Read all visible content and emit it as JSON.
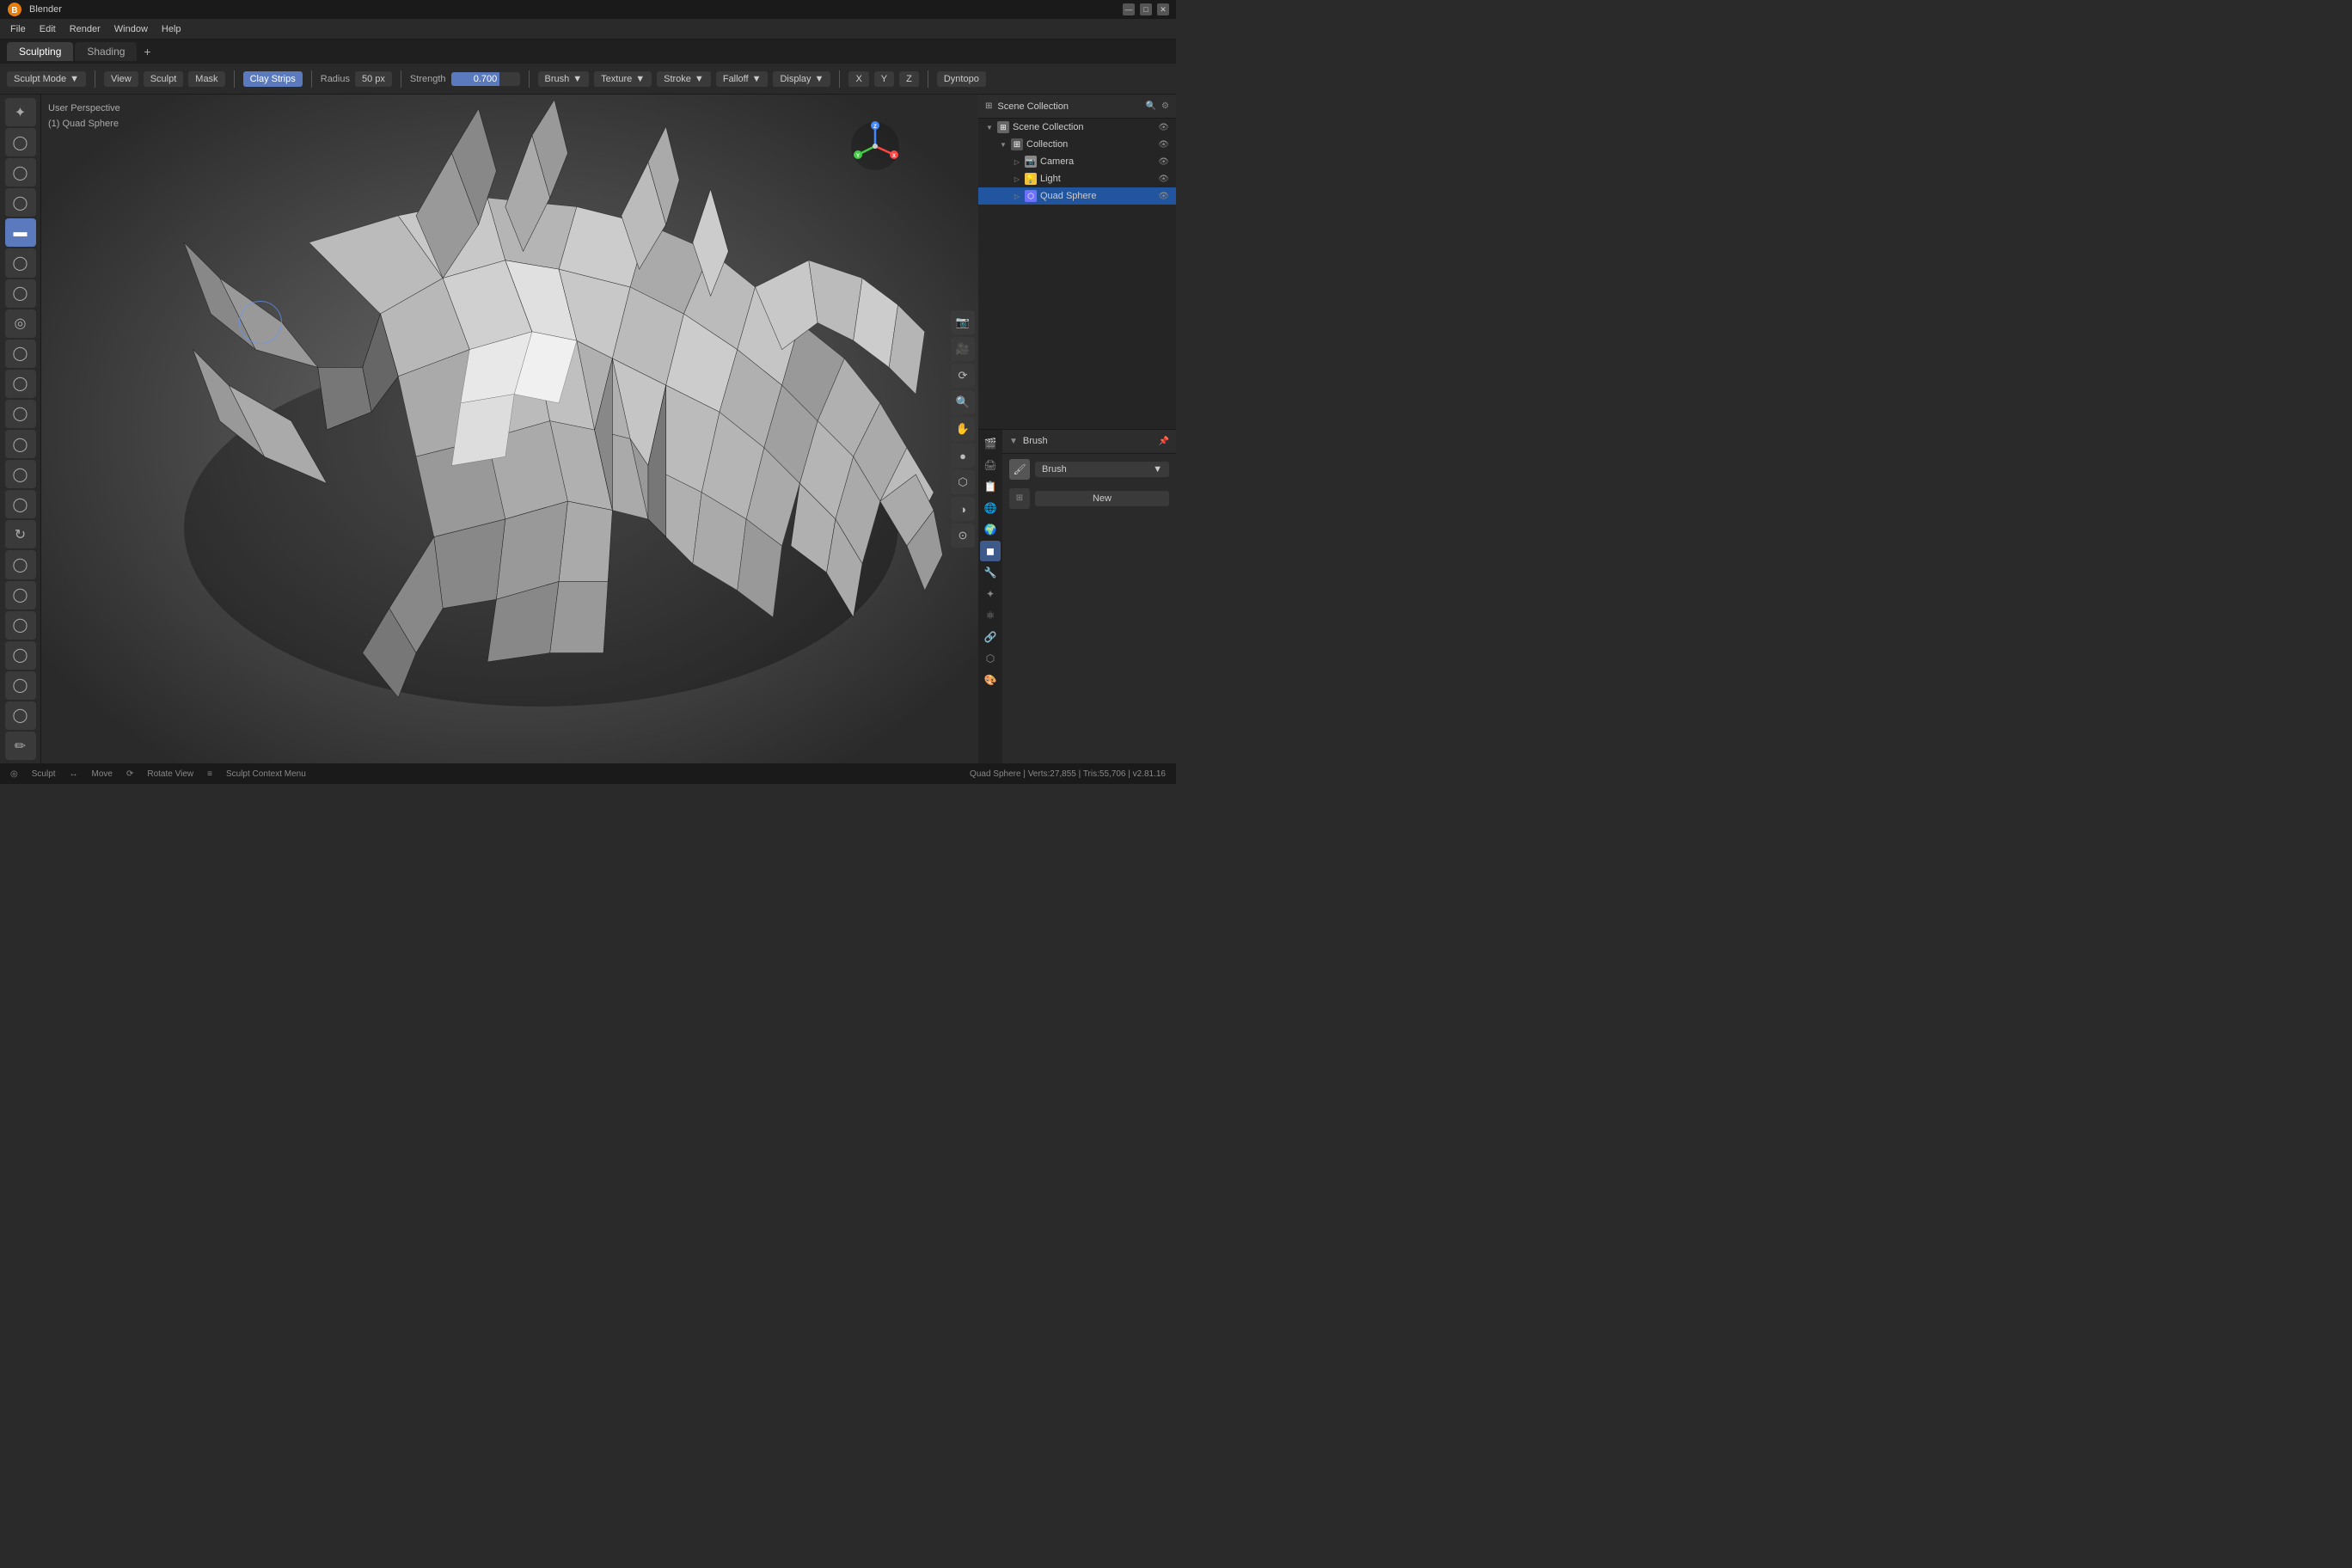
{
  "titleBar": {
    "appName": "Blender",
    "controls": [
      "—",
      "□",
      "✕"
    ]
  },
  "menuBar": {
    "items": [
      "File",
      "Edit",
      "Render",
      "Window",
      "Help"
    ]
  },
  "workspaceTabs": {
    "tabs": [
      "Sculpting",
      "Shading"
    ],
    "activeTab": "Sculpting",
    "addLabel": "+"
  },
  "topToolbar": {
    "modeLabel": "Sculpt Mode",
    "modeDropdown": "▼",
    "viewLabel": "View",
    "sculptLabel": "Sculpt",
    "maskLabel": "Mask",
    "brushName": "Clay Strips",
    "radiusLabel": "Radius",
    "radiusValue": "50 px",
    "strengthLabel": "Strength",
    "strengthValue": "0.700",
    "brushLabel": "Brush",
    "textureLabel": "Texture",
    "strokeLabel": "Stroke",
    "falloffLabel": "Falloff",
    "displayLabel": "Display",
    "dyntopo": "Dyntopo",
    "xLabel": "X",
    "yLabel": "Y",
    "zLabel": "Z"
  },
  "viewport": {
    "perspLabel": "User Perspective",
    "objectLabel": "(1) Quad Sphere"
  },
  "outliner": {
    "title": "Scene Collection",
    "items": [
      {
        "name": "Collection",
        "type": "collection",
        "icon": "🗂",
        "indent": 0,
        "expanded": true
      },
      {
        "name": "Camera",
        "type": "camera",
        "icon": "📷",
        "indent": 1
      },
      {
        "name": "Light",
        "type": "light",
        "icon": "💡",
        "indent": 1
      },
      {
        "name": "Quad Sphere",
        "type": "mesh",
        "icon": "⬡",
        "indent": 1,
        "active": true
      }
    ]
  },
  "brushPanel": {
    "title": "Brush",
    "brushType": "Brush",
    "newLabel": "New"
  },
  "statusBar": {
    "sculptLabel": "Sculpt",
    "moveLabel": "Move",
    "rotateLabel": "Rotate View",
    "contextLabel": "Sculpt Context Menu",
    "statsLabel": "Quad Sphere | Verts:27,855 | Tris:55,706 | v2.81.16"
  },
  "leftTools": {
    "tools": [
      "◎",
      "◯",
      "◯",
      "◯",
      "◉",
      "◯",
      "◯",
      "◯",
      "◯",
      "◯",
      "◯",
      "◯",
      "◯",
      "◯",
      "◯",
      "◯",
      "◯",
      "◯",
      "◯",
      "◯",
      "◯",
      "◯"
    ]
  },
  "propsIcons": {
    "icons": [
      "🎬",
      "🔧",
      "⚙",
      "🌐",
      "🎨",
      "💡",
      "🎯",
      "📦",
      "🔩",
      "🎲",
      "🖌",
      "⬡"
    ]
  }
}
